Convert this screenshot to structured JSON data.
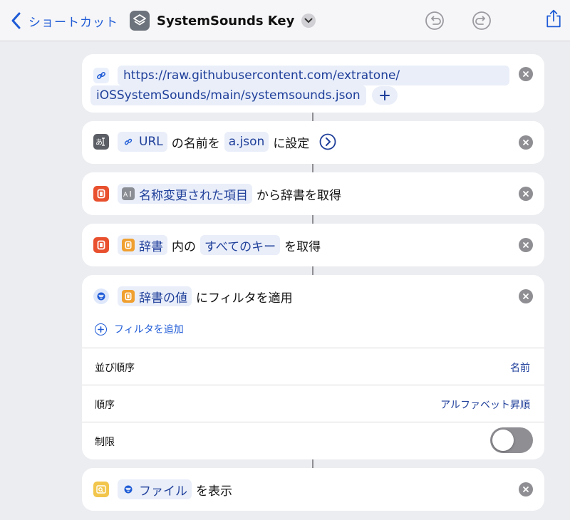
{
  "header": {
    "back_label": "ショートカット",
    "title": "SystemSounds Key"
  },
  "actions": {
    "url": {
      "line1": "https://raw.githubusercontent.com/extratone/",
      "line2": "iOSSystemSounds/main/systemsounds.json"
    },
    "set_name": {
      "token_url": "URL",
      "text1": "の名前を",
      "token_name": "a.json",
      "text2": "に設定"
    },
    "get_dict": {
      "token": "名称変更された項目",
      "text": "から辞書を取得"
    },
    "get_keys": {
      "token_dict": "辞書",
      "text1": "内の",
      "token_keys": "すべてのキー",
      "text2": "を取得"
    },
    "filter": {
      "token": "辞書の値",
      "text": "にフィルタを適用",
      "add_filter": "フィルタを追加",
      "options": [
        {
          "label": "並び順序",
          "value": "名前"
        },
        {
          "label": "順序",
          "value": "アルファベット昇順"
        },
        {
          "label": "制限",
          "value": ""
        }
      ],
      "limit_enabled": false
    },
    "show": {
      "token": "ファイル",
      "text": "を表示"
    }
  },
  "colors": {
    "accent": "#1f5bd6",
    "token_text": "#1f3f9a",
    "token_bg": "#e9eef9",
    "background": "#ecedf1"
  },
  "icons": {
    "back": "chevron-left-icon",
    "app": "layers-icon",
    "undo": "undo-icon",
    "redo": "redo-icon",
    "share": "share-icon",
    "remove": "close-icon"
  }
}
